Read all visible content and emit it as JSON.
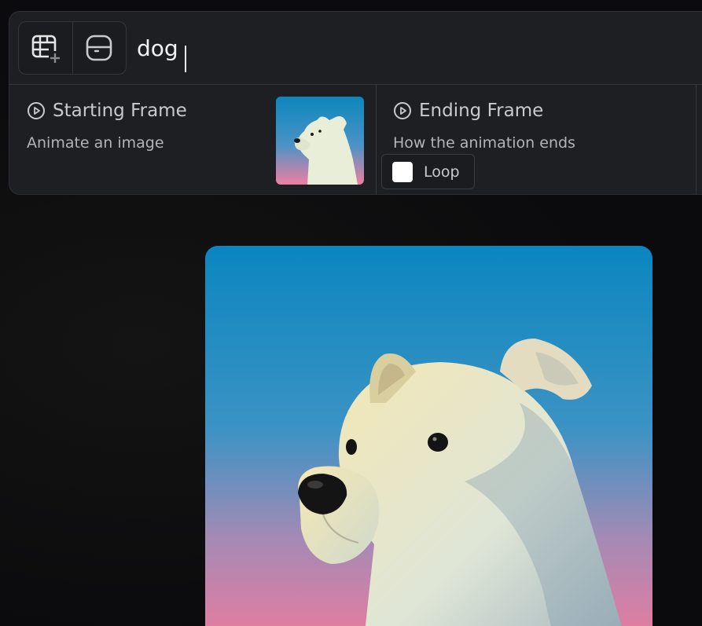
{
  "prompt": {
    "value": "dog"
  },
  "toolbar": {
    "video_add_icon": "film-plus-icon",
    "frame_icon": "frame-icon"
  },
  "starting_frame": {
    "title": "Starting Frame",
    "subtitle": "Animate an image",
    "icon": "play-circle-icon"
  },
  "ending_frame": {
    "title": "Ending Frame",
    "subtitle": "How the animation ends",
    "icon": "play-circle-icon",
    "loop_label": "Loop",
    "loop_checked": false
  },
  "colors": {
    "panel_bg": "#1e1f23",
    "page_bg": "#0b0b0d",
    "image_sky_top": "#0d86bd",
    "image_sky_bottom": "#e9799c"
  }
}
